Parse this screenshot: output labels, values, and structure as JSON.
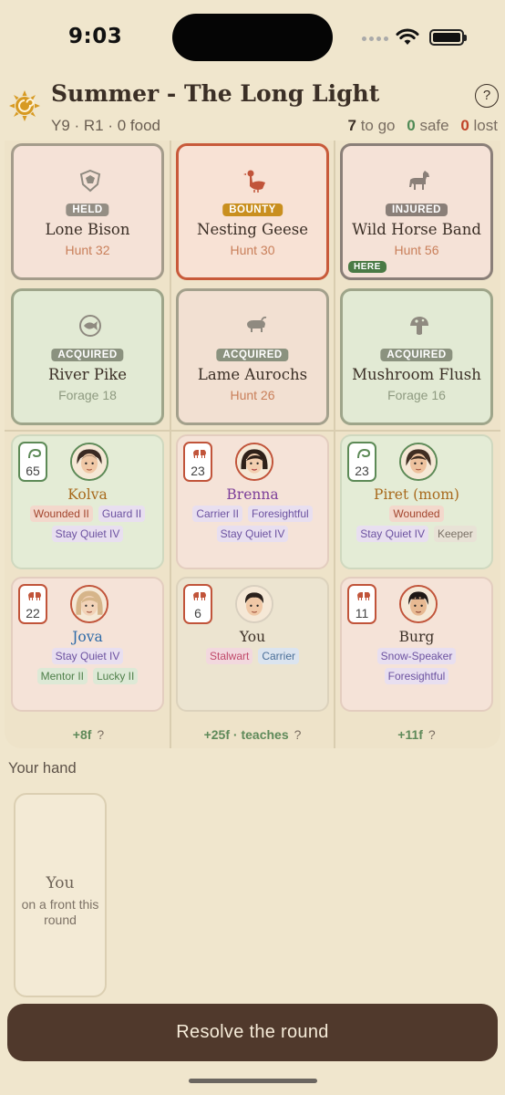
{
  "status": {
    "time": "9:03"
  },
  "header": {
    "title": "Summer - The Long Light",
    "subline": "Y9 · R1 · 0 food",
    "to_go_n": "7",
    "to_go_label": "to go",
    "safe_n": "0",
    "safe_label": "safe",
    "lost_n": "0",
    "lost_label": "lost",
    "help_label": "?"
  },
  "threats": [
    {
      "icon": "crest-icon",
      "badge": "HELD",
      "name": "Lone Bison",
      "sub": "Hunt 32"
    },
    {
      "icon": "goose-icon",
      "badge": "BOUNTY",
      "name": "Nesting Geese",
      "sub": "Hunt 30"
    },
    {
      "icon": "horse-icon",
      "badge": "INJURED",
      "name": "Wild Horse Band",
      "sub": "Hunt 56",
      "flag": "HERE"
    },
    {
      "icon": "fish-icon",
      "badge": "ACQUIRED",
      "name": "River Pike",
      "sub": "Forage 18"
    },
    {
      "icon": "aurochs-icon",
      "badge": "ACQUIRED",
      "name": "Lame Aurochs",
      "sub": "Hunt 26"
    },
    {
      "icon": "mushroom-icon",
      "badge": "ACQUIRED",
      "name": "Mushroom Flush",
      "sub": "Forage 16"
    }
  ],
  "people": [
    {
      "name": "Kolva",
      "value": "65",
      "role_icon": "forage-icon",
      "tags": [
        "Wounded II",
        "Guard II",
        "Stay Quiet IV"
      ]
    },
    {
      "name": "Brenna",
      "value": "23",
      "role_icon": "hunt-icon",
      "tags": [
        "Carrier II",
        "Foresightful",
        "Stay Quiet IV"
      ]
    },
    {
      "name": "Piret (mom)",
      "value": "23",
      "role_icon": "forage-icon",
      "tags": [
        "Wounded",
        "Stay Quiet IV",
        "Keeper"
      ]
    },
    {
      "name": "Jova",
      "value": "22",
      "role_icon": "hunt-icon",
      "tags": [
        "Stay Quiet IV",
        "Mentor II",
        "Lucky II"
      ]
    },
    {
      "name": "You",
      "value": "6",
      "role_icon": "hunt-icon",
      "tags": [
        "Stalwart",
        "Carrier"
      ]
    },
    {
      "name": "Burg",
      "value": "11",
      "role_icon": "hunt-icon",
      "tags": [
        "Snow-Speaker",
        "Foresightful"
      ]
    }
  ],
  "columns": [
    {
      "food": "+8f",
      "extra": "",
      "q": "?"
    },
    {
      "food": "+25f",
      "extra": "· teaches",
      "q": "?"
    },
    {
      "food": "+11f",
      "extra": "",
      "q": "?"
    }
  ],
  "hand": {
    "label": "Your hand",
    "card_name": "You",
    "card_sub": "on a front this round"
  },
  "resolve_label": "Resolve the round",
  "colors": {
    "background": "#f0e6cd",
    "hunt": "#c1543a",
    "forage": "#5d8a57",
    "bounty": "#c98f1f",
    "button": "#50392c"
  }
}
